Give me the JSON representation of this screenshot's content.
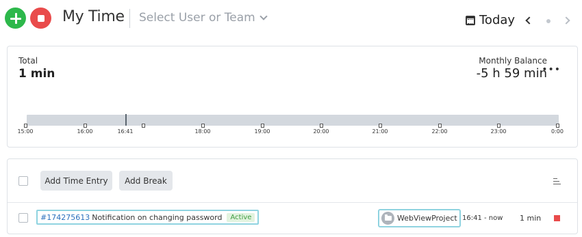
{
  "colors": {
    "add": "#2db84b",
    "stop": "#e94b4b",
    "link": "#2a6fbd",
    "active_badge_bg": "#e2f3df",
    "active_badge_text": "#3f9c41",
    "highlight_border": "#8fd3e0"
  },
  "header": {
    "add_icon": "plus-icon",
    "stop_icon": "stop-icon",
    "title": "My Time",
    "user_select_placeholder": "Select User or Team",
    "date_label": "Today",
    "calendar_icon": "calendar-icon",
    "prev_icon": "chevron-left-icon",
    "next_icon": "chevron-right-icon"
  },
  "summary": {
    "total_label": "Total",
    "total_value": "1 min",
    "monthly_balance_label": "Monthly Balance",
    "monthly_balance_value": "-5 h 59 min",
    "more_icon": "more-icon",
    "timeline": {
      "now_label": "16:41",
      "ticks": [
        "15:00",
        "16:00",
        "16:41",
        "18:00",
        "19:00",
        "20:00",
        "21:00",
        "22:00",
        "23:00",
        "0:00"
      ]
    }
  },
  "entries": {
    "add_time_entry_label": "Add Time Entry",
    "add_break_label": "Add Break",
    "sort_icon": "sort-icon",
    "rows": [
      {
        "task_id": "#174275613",
        "task_name": "Notification on changing password",
        "status": "Active",
        "project": "WebViewProject",
        "project_icon": "folder-icon",
        "time_range": "16:41 - now",
        "duration": "1 min",
        "stop_icon": "stop-icon"
      }
    ]
  }
}
